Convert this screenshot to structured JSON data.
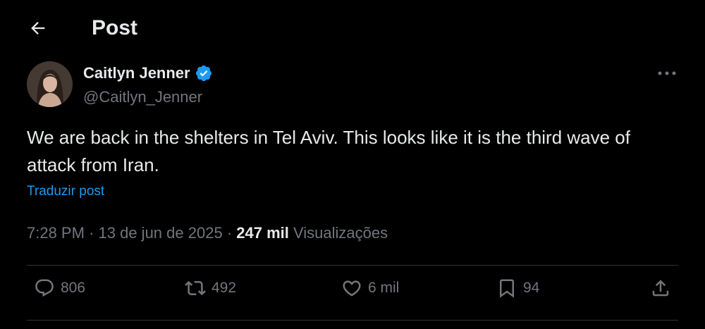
{
  "header": {
    "title": "Post",
    "back_icon": "arrow-left-icon"
  },
  "author": {
    "name": "Caitlyn Jenner",
    "handle": "@Caitlyn_Jenner",
    "verified_icon": "verified-badge-icon",
    "verified_color": "#1d9bf0"
  },
  "post": {
    "text": "We are back in the shelters in Tel Aviv. This looks like it is the third wave of attack from Iran.",
    "translate_label": "Traduzir post",
    "time": "7:28 PM",
    "separator": "·",
    "date": "13 de jun de 2025",
    "views_count": "247 mil",
    "views_label": "Visualizações"
  },
  "actions": {
    "replies": "806",
    "reposts": "492",
    "likes": "6 mil",
    "bookmarks": "94"
  },
  "colors": {
    "background": "#000000",
    "text_primary": "#e7e9ea",
    "text_secondary": "#71767b",
    "accent": "#1d9bf0",
    "divider": "#2f3336"
  }
}
